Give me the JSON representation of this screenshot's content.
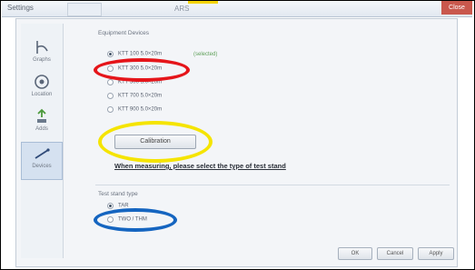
{
  "window": {
    "title": "Settings",
    "close_label": "Close",
    "tab_mid_label": "ARS"
  },
  "sidebar": {
    "items": [
      {
        "label": "Graphs",
        "icon": "pen-curve-icon"
      },
      {
        "label": "Location",
        "icon": "gauge-icon"
      },
      {
        "label": "Adds",
        "icon": "arrow-stack-icon"
      },
      {
        "label": "Devices",
        "icon": "device-line-icon"
      }
    ]
  },
  "device_group": {
    "title": "Equipment Devices",
    "options": [
      {
        "label": "KTT 100 5.0×20m",
        "selected": true
      },
      {
        "label": "KTT 300 5.0×20m",
        "selected": false
      },
      {
        "label": "KTT 500 5.0×20m",
        "selected": false
      },
      {
        "label": "KTT 700 5.0×20m",
        "selected": false
      },
      {
        "label": "KTT 900 5.0×20m",
        "selected": false
      }
    ],
    "selected_note": "(selected)"
  },
  "calibration_button": "Calibration",
  "hint_text": "When measuring, please select the type of test stand",
  "stand_group": {
    "title": "Test stand type",
    "options": [
      {
        "label": "TAR",
        "selected": true
      },
      {
        "label": "TWO / THM",
        "selected": false
      }
    ]
  },
  "footer": {
    "ok_label": "OK",
    "cancel_label": "Cancel",
    "apply_label": "Apply"
  },
  "annotations": {
    "red": "#e5151a",
    "yellow": "#f5e400",
    "blue": "#1565c0"
  }
}
